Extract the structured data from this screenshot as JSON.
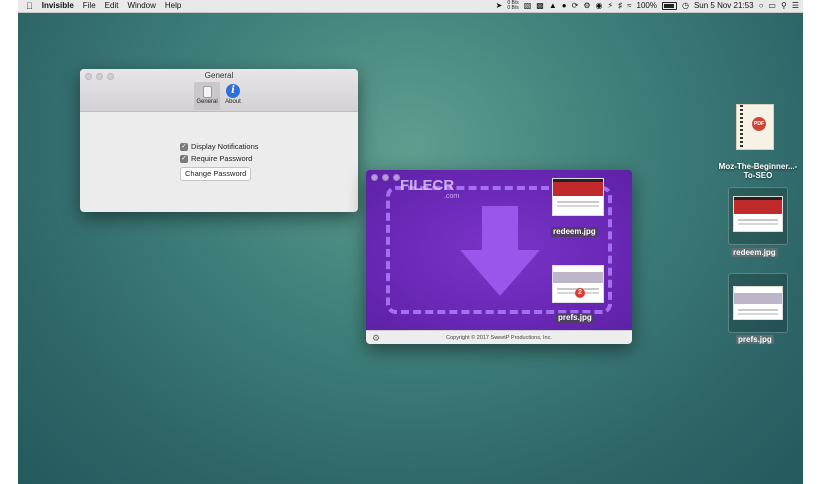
{
  "menubar": {
    "apple": "",
    "app_name": "Invisible",
    "menus": [
      "File",
      "Edit",
      "Window",
      "Help"
    ],
    "net_up": "0 B/s",
    "net_down": "0 B/s",
    "battery": "100%",
    "datetime": "Sun 5 Nov  21:53"
  },
  "prefs_window": {
    "title": "General",
    "toolbar": [
      {
        "label": "General",
        "icon": "general-icon",
        "selected": true
      },
      {
        "label": "About",
        "icon": "info-icon",
        "selected": false
      }
    ],
    "options": [
      {
        "label": "Display Notifications",
        "checked": true
      },
      {
        "label": "Require Password",
        "checked": true
      }
    ],
    "change_password_label": "Change Password"
  },
  "app_window": {
    "watermark": "FILECR",
    "watermark_sub": ".com",
    "files": [
      {
        "name": "redeem.jpg"
      },
      {
        "name": "prefs.jpg",
        "badge": "2"
      }
    ],
    "copyright": "Copyright © 2017 SweetP Productions, Inc.",
    "accent": "#6b2bb4"
  },
  "desktop_icons": [
    {
      "label": "Moz-The-Beginner...-To-SEO"
    },
    {
      "label": "redeem.jpg"
    },
    {
      "label": "prefs.jpg"
    }
  ]
}
